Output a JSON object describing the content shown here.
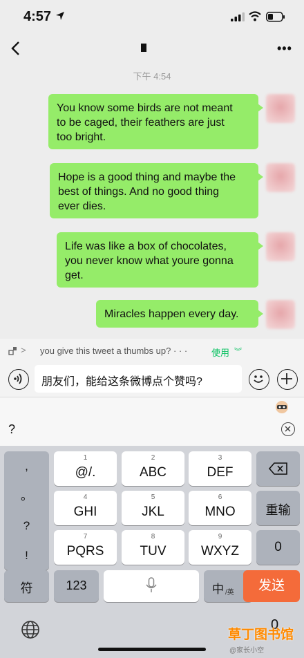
{
  "status_bar": {
    "time": "4:57"
  },
  "chat": {
    "timestamp": "下午 4:54",
    "messages": [
      {
        "line1": "You know some birds are not meant",
        "line2": "to be caged, their feathers are just",
        "line3": "too bright."
      },
      {
        "line1": "Hope is a good thing and maybe the",
        "line2": " best of things. And no good thing",
        "line3": "ever dies."
      },
      {
        "line1": "Life was like a box of chocolates,",
        "line2": "you never know what youre gonna",
        "line3": "get."
      },
      {
        "line1": "Miracles happen every day."
      }
    ]
  },
  "quote_bar": {
    "text": "you give this tweet a thumbs up? · · ·",
    "use_label": "使用"
  },
  "input": {
    "value": "朋友们，能给这条微博点个赞吗?"
  },
  "candidates": {
    "first": "?"
  },
  "keyboard": {
    "punct": [
      ",",
      "。",
      "?",
      "!"
    ],
    "keys": [
      {
        "num": "1",
        "label": "@/."
      },
      {
        "num": "2",
        "label": "ABC"
      },
      {
        "num": "3",
        "label": "DEF"
      },
      {
        "num": "4",
        "label": "GHI"
      },
      {
        "num": "5",
        "label": "JKL"
      },
      {
        "num": "6",
        "label": "MNO"
      },
      {
        "num": "7",
        "label": "PQRS"
      },
      {
        "num": "8",
        "label": "TUV"
      },
      {
        "num": "9",
        "label": "WXYZ"
      }
    ],
    "reenter": "重输",
    "zero": "0",
    "symbols": "符",
    "numbers": "123",
    "lang_zh": "中",
    "lang_en": "/英",
    "send": "发送",
    "floating_zero": "0"
  },
  "watermark": {
    "text": "草丁图书馆",
    "handle": "@家长小空"
  }
}
